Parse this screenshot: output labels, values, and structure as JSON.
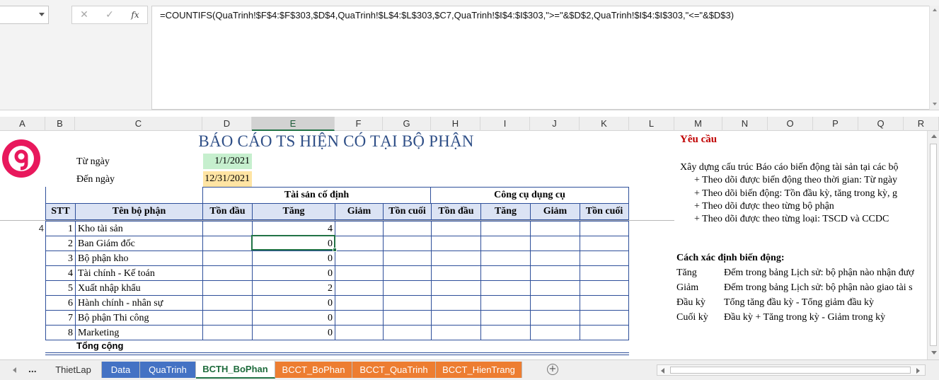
{
  "formula_bar": {
    "formula": "=COUNTIFS(QuaTrinh!$F$4:$F$303,$D$4,QuaTrinh!$L$4:$L$303,$C7,QuaTrinh!$I$4:$I$303,\">=\"&$D$2,QuaTrinh!$I$4:$I$303,\"<=\"&$D$3)",
    "cancel_glyph": "✕",
    "enter_glyph": "✓",
    "fx_label": "fx"
  },
  "columns": [
    "A",
    "B",
    "C",
    "D",
    "E",
    "F",
    "G",
    "H",
    "I",
    "J",
    "K",
    "L",
    "M",
    "N",
    "O",
    "P",
    "Q",
    "R"
  ],
  "selected_column": "E",
  "row_number": "4",
  "report": {
    "title": "BÁO CÁO TS HIỆN CÓ TẠI BỘ PHẬN",
    "from_label": "Từ ngày",
    "from_value": "1/1/2021",
    "to_label": "Đến ngày",
    "to_value": "12/31/2021",
    "group_fixed_assets": "Tài sản cố định",
    "group_tools": "Công cụ dụng cụ",
    "headers": {
      "stt": "STT",
      "dept": "Tên bộ phận",
      "ts_open": "Tồn đầu",
      "ts_inc": "Tăng",
      "ts_dec": "Giảm",
      "ts_close": "Tồn cuối",
      "cc_open": "Tồn đầu",
      "cc_inc": "Tăng",
      "cc_dec": "Giảm",
      "cc_close": "Tồn cuối"
    },
    "rows": [
      {
        "stt": "1",
        "dept": "Kho tài sản",
        "ts_inc": "4"
      },
      {
        "stt": "2",
        "dept": "Ban Giám đốc",
        "ts_inc": "0"
      },
      {
        "stt": "3",
        "dept": "Bộ phận kho",
        "ts_inc": "0"
      },
      {
        "stt": "4",
        "dept": "Tài chính - Kế toán",
        "ts_inc": "0"
      },
      {
        "stt": "5",
        "dept": "Xuất nhập khẩu",
        "ts_inc": "2"
      },
      {
        "stt": "6",
        "dept": "Hành chính - nhân sự",
        "ts_inc": "0"
      },
      {
        "stt": "7",
        "dept": "Bộ phận Thi công",
        "ts_inc": "0"
      },
      {
        "stt": "8",
        "dept": "Marketing",
        "ts_inc": "0"
      }
    ],
    "total_label": "Tổng cộng"
  },
  "notes": {
    "title": "Yêu cầu",
    "intro": "Xây dựng cấu trúc Báo cáo biến động tài sản tại các bộ",
    "bullets": [
      "+ Theo dõi được biến động theo thời gian: Từ ngày",
      "+ Theo dõi biến động: Tồn đầu kỳ, tăng trong kỳ, g",
      "+ Theo dõi được theo từng bộ phận",
      "+ Theo dõi được theo từng loại: TSCD và CCDC"
    ],
    "method_title": "Cách xác định biến động:",
    "methods": [
      {
        "key": "Tăng",
        "value": "Đếm trong bảng Lịch sử: bộ phận nào nhận đượ"
      },
      {
        "key": "Giảm",
        "value": "Đếm trong bảng Lịch sử: bộ phận nào giao tài s"
      },
      {
        "key": "Đầu kỳ",
        "value": "Tổng tăng đầu kỳ - Tổng giảm đầu kỳ"
      },
      {
        "key": "Cuối kỳ",
        "value": "Đầu kỳ + Tăng trong kỳ - Giảm trong kỳ"
      }
    ]
  },
  "tabs": {
    "more": "...",
    "items": [
      {
        "label": "ThietLap",
        "color": "#efefef",
        "text": "#333333"
      },
      {
        "label": "Data",
        "color": "#4472c4",
        "text": "#ffffff"
      },
      {
        "label": "QuaTrinh",
        "color": "#4472c4",
        "text": "#ffffff"
      },
      {
        "label": "BCTH_BoPhan",
        "color": "#ffffff",
        "text": "#1e6b3c"
      },
      {
        "label": "BCCT_BoPhan",
        "color": "#ed7d31",
        "text": "#ffffff"
      },
      {
        "label": "BCCT_QuaTrinh",
        "color": "#ed7d31",
        "text": "#ffffff"
      },
      {
        "label": "BCCT_HienTrang",
        "color": "#ed7d31",
        "text": "#ffffff"
      }
    ],
    "active": "BCTH_BoPhan",
    "add_glyph": "+"
  },
  "colors": {
    "accent_green": "#217346",
    "title_blue": "#2f4f87",
    "header_fill": "#dbe3f4",
    "date_from_fill": "#c6efce",
    "date_to_fill": "#ffe4a3",
    "note_title_red": "#c00000"
  },
  "icons": {
    "logo": "brand-logo-g",
    "cancel": "close-icon",
    "enter": "check-icon",
    "function": "function-icon",
    "add_sheet": "plus-circle-icon"
  }
}
